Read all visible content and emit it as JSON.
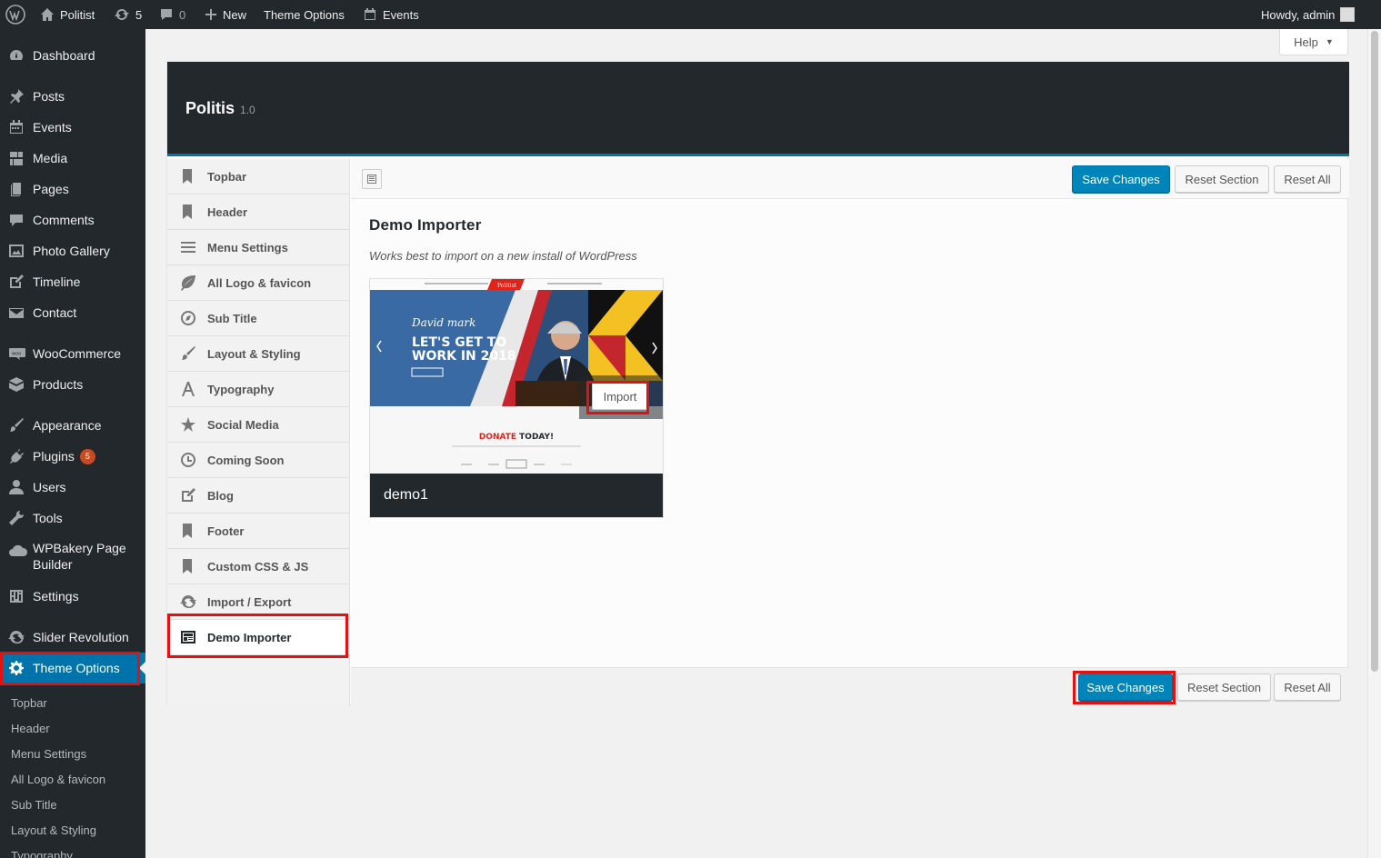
{
  "adminbar": {
    "site_name": "Politist",
    "updates_count": "5",
    "comments_count": "0",
    "new_label": "New",
    "theme_options_label": "Theme Options",
    "events_label": "Events",
    "howdy": "Howdy, admin"
  },
  "sidebar": {
    "items": [
      {
        "label": "Dashboard",
        "icon": "dashboard-icon"
      },
      {
        "label": "Posts",
        "icon": "pin-icon"
      },
      {
        "label": "Events",
        "icon": "calendar-icon"
      },
      {
        "label": "Media",
        "icon": "media-icon"
      },
      {
        "label": "Pages",
        "icon": "pages-icon"
      },
      {
        "label": "Comments",
        "icon": "comment-icon"
      },
      {
        "label": "Photo Gallery",
        "icon": "gallery-icon"
      },
      {
        "label": "Timeline",
        "icon": "edit-icon"
      },
      {
        "label": "Contact",
        "icon": "mail-icon"
      },
      {
        "label": "WooCommerce",
        "icon": "woo-icon"
      },
      {
        "label": "Products",
        "icon": "archive-icon"
      },
      {
        "label": "Appearance",
        "icon": "brush-icon"
      },
      {
        "label": "Plugins",
        "icon": "plugin-icon",
        "badge": "5"
      },
      {
        "label": "Users",
        "icon": "user-icon"
      },
      {
        "label": "Tools",
        "icon": "wrench-icon"
      },
      {
        "label_line1": "WPBakery Page",
        "label_line2": "Builder",
        "icon": "cloud-icon"
      },
      {
        "label": "Settings",
        "icon": "settings-icon"
      },
      {
        "label": "Slider Revolution",
        "icon": "refresh-icon"
      },
      {
        "label": "Theme Options",
        "icon": "gear-icon",
        "current": true
      }
    ],
    "submenu": [
      "Topbar",
      "Header",
      "Menu Settings",
      "All Logo & favicon",
      "Sub Title",
      "Layout & Styling",
      "Typography"
    ]
  },
  "help_label": "Help",
  "redux": {
    "title": "Politis",
    "version": "1.0",
    "nav": [
      {
        "label": "Topbar",
        "icon": "bookmark-icon"
      },
      {
        "label": "Header",
        "icon": "bookmark-icon"
      },
      {
        "label": "Menu Settings",
        "icon": "menu-lines-icon"
      },
      {
        "label": "All Logo & favicon",
        "icon": "leaf-icon"
      },
      {
        "label": "Sub Title",
        "icon": "compass-icon"
      },
      {
        "label": "Layout & Styling",
        "icon": "brush-icon"
      },
      {
        "label": "Typography",
        "icon": "font-icon"
      },
      {
        "label": "Social Media",
        "icon": "star-icon"
      },
      {
        "label": "Coming Soon",
        "icon": "clock-icon"
      },
      {
        "label": "Blog",
        "icon": "edit-icon"
      },
      {
        "label": "Footer",
        "icon": "bookmark-icon"
      },
      {
        "label": "Custom CSS & JS",
        "icon": "bookmark-icon"
      },
      {
        "label": "Import / Export",
        "icon": "refresh-icon"
      },
      {
        "label": "Demo Importer",
        "icon": "importer-icon",
        "active": true
      }
    ],
    "save_label": "Save Changes",
    "reset_section_label": "Reset Section",
    "reset_all_label": "Reset All",
    "section_title": "Demo Importer",
    "section_desc": "Works best to import on a new install of WordPress",
    "demo": {
      "name": "demo1",
      "import_label": "Import",
      "preview": {
        "brand": "Politist",
        "signature": "David mark",
        "headline1": "LET'S GET TO",
        "headline2": "WORK IN 2018",
        "donate_prefix": "DONATE ",
        "donate_word": "TODAY!"
      }
    }
  },
  "colors": {
    "admin_dark": "#23282d",
    "primary": "#0073aa",
    "highlight_red": "#e21212",
    "badge": "#ca4a1f"
  }
}
